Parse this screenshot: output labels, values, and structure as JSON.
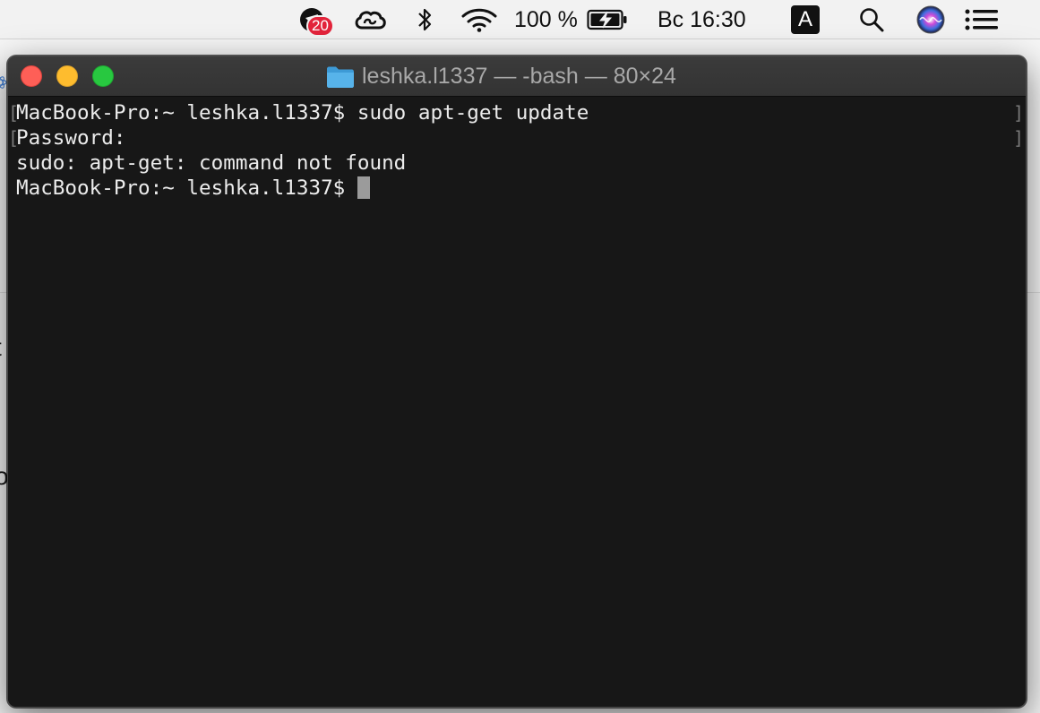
{
  "menubar": {
    "notification_count": "20",
    "battery_percent": "100 %",
    "clock": "Вс 16:30",
    "input_source": "A",
    "icons": [
      "notifications-icon",
      "creative-cloud-icon",
      "bluetooth-icon",
      "wifi-icon",
      "battery-charging-icon",
      "spotlight-search-icon",
      "siri-icon",
      "notification-center-icon"
    ]
  },
  "terminal": {
    "title": "leshka.l1337 — -bash — 80×24",
    "title_icon": "folder-icon",
    "lines": [
      "MacBook-Pro:~ leshka.l1337$ sudo apt-get update",
      "Password:",
      "sudo: apt-get: command not found",
      "MacBook-Pro:~ leshka.l1337$ "
    ],
    "colors": {
      "background": "#171717",
      "text": "#ececec",
      "cursor": "#9b9b9b"
    }
  },
  "background_app": {
    "partial_chars": [
      "t",
      "o"
    ]
  },
  "traffic_lights": {
    "close": "#fe5f57",
    "minimize": "#febc2e",
    "maximize": "#28c840"
  }
}
